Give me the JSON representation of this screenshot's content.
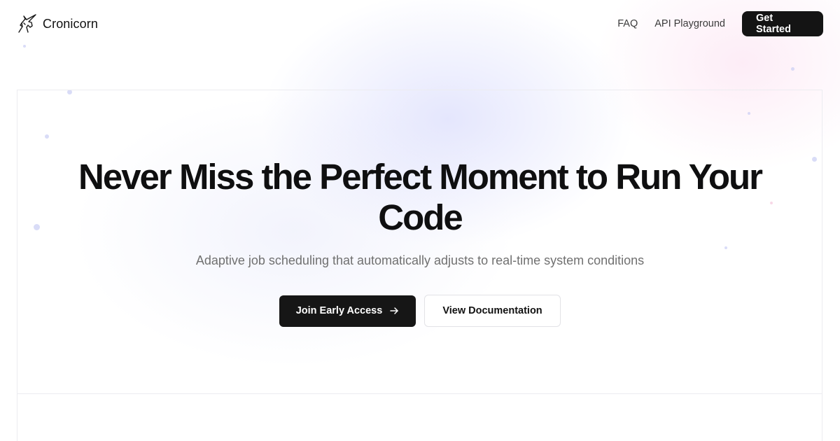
{
  "brand": {
    "name": "Cronicorn",
    "logo_icon": "unicorn-icon"
  },
  "nav": {
    "links": [
      {
        "label": "FAQ"
      },
      {
        "label": "API Playground"
      }
    ],
    "cta_label": "Get Started"
  },
  "hero": {
    "title": "Never Miss the Perfect Moment to Run Your Code",
    "subtitle": "Adaptive job scheduling that automatically adjusts to real-time system conditions",
    "primary_cta": {
      "label": "Join Early Access",
      "icon": "arrow-right-icon"
    },
    "secondary_cta": {
      "label": "View Documentation"
    }
  },
  "colors": {
    "primary_button": "#161616",
    "text": "#0f0f10",
    "muted_text": "#707070",
    "accent_glow": "#c4c8fa",
    "pink_glow": "#fad6ec"
  }
}
